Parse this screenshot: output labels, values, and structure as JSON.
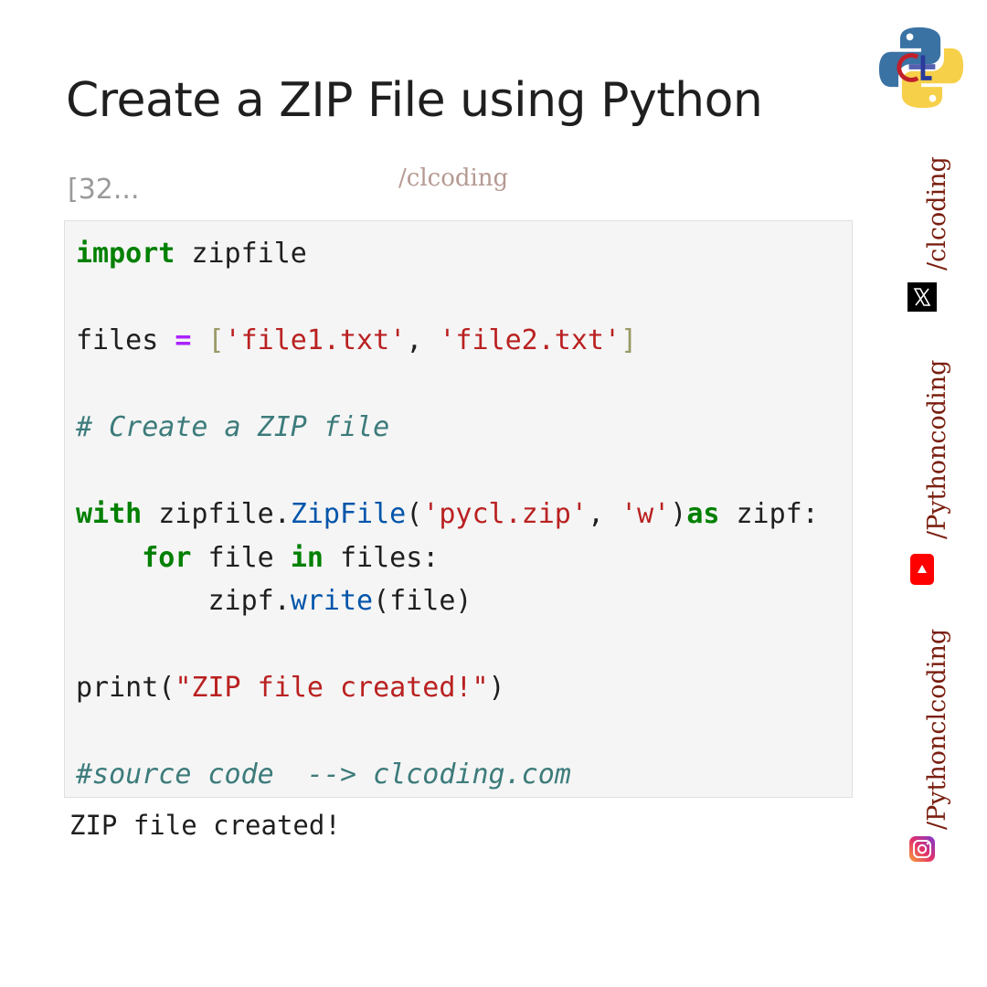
{
  "title": "Create a ZIP File using Python",
  "cell_prompt": "[32...",
  "watermark": "/clcoding",
  "code_lines": {
    "l1": {
      "kw": "import",
      "rest": " zipfile"
    },
    "l3": {
      "a": "files ",
      "op": "=",
      "b": " ",
      "br1": "[",
      "s1": "'file1.txt'",
      "c": ", ",
      "s2": "'file2.txt'",
      "br2": "]"
    },
    "l5": "# Create a ZIP file",
    "l7": {
      "kw1": "with",
      "a": " zipfile.",
      "fn": "ZipFile",
      "b": "(",
      "s1": "'pycl.zip'",
      "c": ", ",
      "s2": "'w'",
      "d": ")",
      "kw2": "as",
      "e": " zipf:"
    },
    "l8": {
      "indent": "    ",
      "kw1": "for",
      "a": " file ",
      "kw2": "in",
      "b": " files:"
    },
    "l9": {
      "indent": "        ",
      "a": "zipf.",
      "fn": "write",
      "b": "(file)"
    },
    "l11": {
      "a": "print(",
      "s": "\"ZIP file created!\"",
      "b": ")"
    },
    "l13": "#source code  --> clcoding.com"
  },
  "output": "ZIP file created!",
  "side_labels": {
    "twitter": "/clcoding",
    "youtube": "/Pythoncoding",
    "instagram": "/Pythonclcoding"
  },
  "icons": {
    "logo": "python-clcoding-logo",
    "twitter": "x-icon",
    "youtube": "youtube-icon",
    "instagram": "instagram-icon"
  },
  "colors": {
    "keyword": "#008000",
    "string": "#ba2121",
    "comment": "#3d7b7b",
    "function": "#0055aa",
    "side_text": "#7a1f10"
  }
}
